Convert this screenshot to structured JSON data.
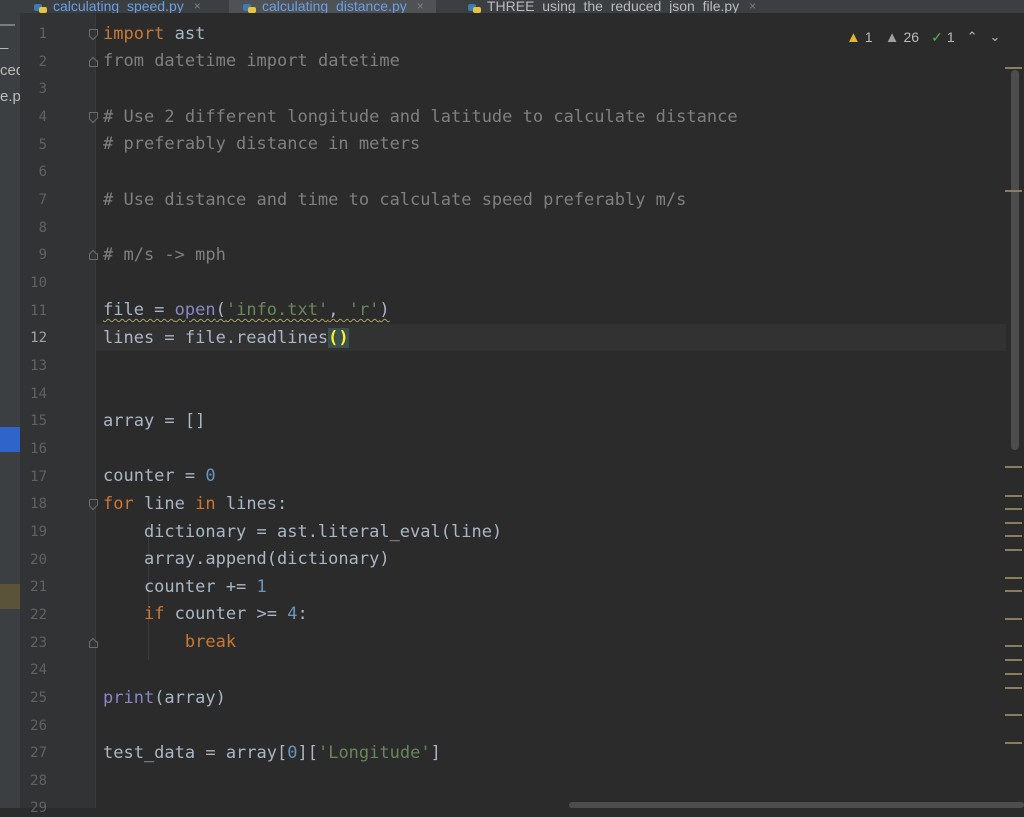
{
  "tabs": [
    {
      "label": "calculating_speed.py",
      "color": "#6a9fe8"
    },
    {
      "label": "calculating_distance.py",
      "color": "#6a9fe8",
      "active": true
    },
    {
      "label": "THREE_using_the_reduced_json_file.py",
      "color": "#bbbbbb"
    }
  ],
  "tab_close_glyph": "×",
  "side_strip": {
    "fragments": [
      "—_",
      "ced",
      "e.p"
    ]
  },
  "inspections": {
    "warnings": "1",
    "weak_warnings": "26",
    "typos": "1",
    "warning_icon": "warning-triangle-icon",
    "weak_warning_icon": "weak-warning-triangle-icon",
    "typo_icon": "typo-check-icon"
  },
  "editor": {
    "current_line": 12,
    "line_numbers": [
      "1",
      "2",
      "3",
      "4",
      "5",
      "6",
      "7",
      "8",
      "9",
      "10",
      "11",
      "12",
      "13",
      "14",
      "15",
      "16",
      "17",
      "18",
      "19",
      "20",
      "21",
      "22",
      "23",
      "24",
      "25",
      "26",
      "27",
      "28",
      "29"
    ],
    "code": {
      "l1_kw": "import",
      "l1_rest": " ast",
      "l2_kw": "from",
      "l2_mid": " datetime ",
      "l2_kw2": "import",
      "l2_rest": " datetime",
      "l4": "# Use 2 different longitude and latitude to calculate distance",
      "l5": "# preferably distance in meters",
      "l7": "# Use distance and time to calculate speed preferably m/s",
      "l9": "# m/s -> mph",
      "l11_a": "file = ",
      "l11_b": "open",
      "l11_c": "(",
      "l11_d": "'info.txt'",
      "l11_e": ", ",
      "l11_f": "'r'",
      "l11_g": ")",
      "l12_a": "lines = file.readlines",
      "l12_b": "()",
      "l15": "array = []",
      "l17_a": "counter = ",
      "l17_b": "0",
      "l18_kw": "for",
      "l18_a": " line ",
      "l18_kw2": "in",
      "l18_b": " lines:",
      "l19": "    dictionary = ast.literal_eval(line)",
      "l20": "    array.append(dictionary)",
      "l21_a": "    counter += ",
      "l21_b": "1",
      "l22_a": "    ",
      "l22_kw": "if",
      "l22_b": " counter >= ",
      "l22_c": "4",
      "l22_d": ":",
      "l23_a": "        ",
      "l23_kw": "break",
      "l25_a": "print",
      "l25_b": "(array)",
      "l27_a": "test_data = array[",
      "l27_b": "0",
      "l27_c": "][",
      "l27_d": "'Longitude'",
      "l27_e": "]"
    }
  }
}
